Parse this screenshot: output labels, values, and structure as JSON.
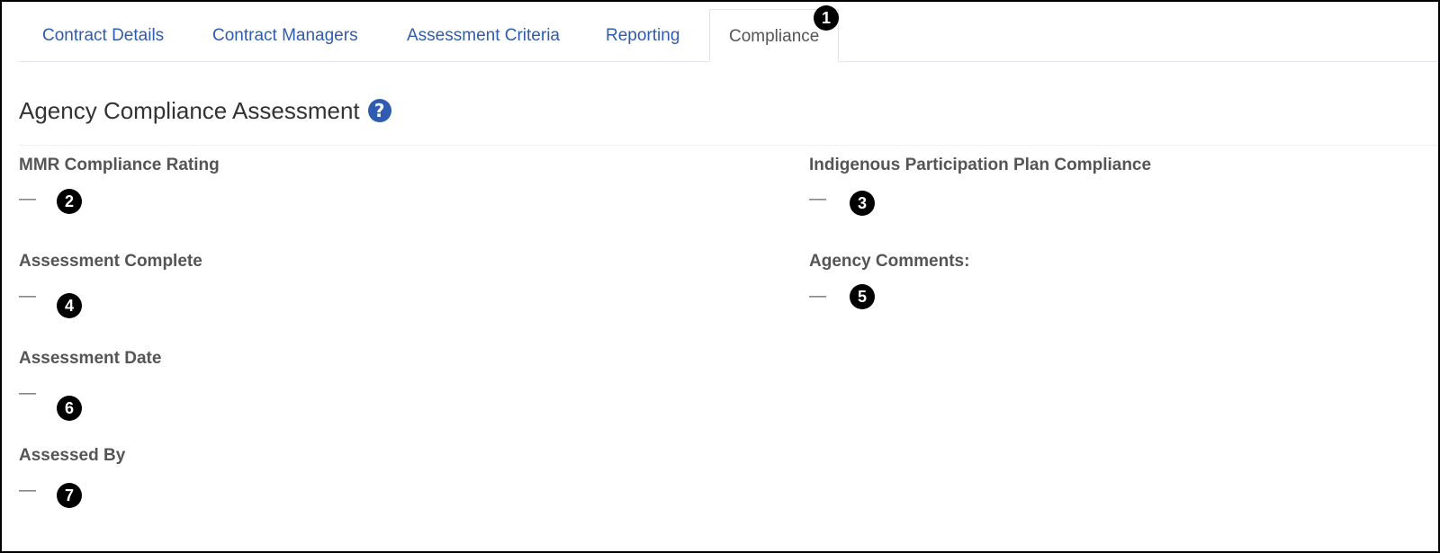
{
  "tabs": [
    {
      "label": "Contract Details"
    },
    {
      "label": "Contract Managers"
    },
    {
      "label": "Assessment Criteria"
    },
    {
      "label": "Reporting"
    },
    {
      "label": "Compliance",
      "active": true
    }
  ],
  "section": {
    "title": "Agency Compliance Assessment",
    "help_icon": "?"
  },
  "fields": {
    "mmr_rating": {
      "label": "MMR Compliance Rating",
      "value": "—"
    },
    "ipp_compliance": {
      "label": "Indigenous Participation Plan Compliance",
      "value": "—"
    },
    "assessment_complete": {
      "label": "Assessment Complete",
      "value": "—"
    },
    "agency_comments": {
      "label": "Agency Comments:",
      "value": "—"
    },
    "assessment_date": {
      "label": "Assessment Date",
      "value": "—"
    },
    "assessed_by": {
      "label": "Assessed By",
      "value": "—"
    }
  },
  "markers": [
    "1",
    "2",
    "3",
    "4",
    "5",
    "6",
    "7"
  ],
  "colors": {
    "accent": "#2f5cae",
    "label": "#555555",
    "marker": "#000000"
  }
}
